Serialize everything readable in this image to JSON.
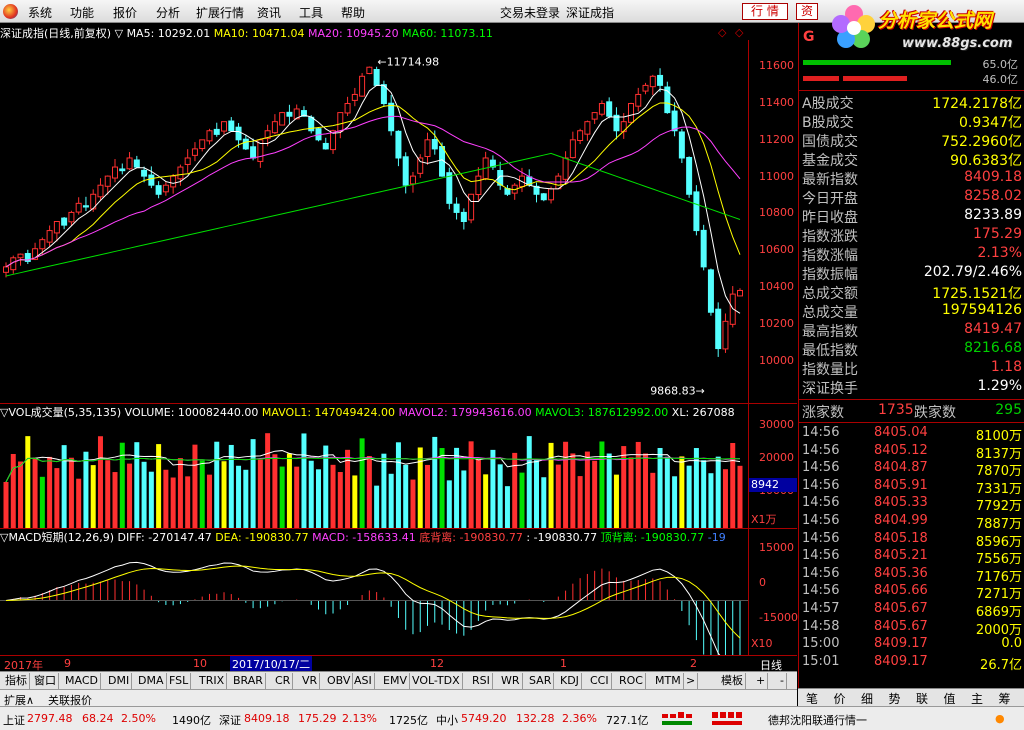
{
  "menu": {
    "items": [
      "系统",
      "功能",
      "报价",
      "分析",
      "扩展行情",
      "资讯",
      "工具",
      "帮助"
    ],
    "login_status": "交易未登录",
    "current_index": "深证成指",
    "btn_quotes": "行 情",
    "btn_info": "资"
  },
  "brand": {
    "title": "分析家公式网",
    "url": "www.88gs.com"
  },
  "main_info": {
    "name": "深证成指(日线,前复权)",
    "ma5": "MA5: 10292.01",
    "ma10": "MA10: 10471.04",
    "ma20": "MA20: 10945.20",
    "ma60": "MA60: 11073.11",
    "high_mark": "11714.98",
    "low_mark": "9868.83"
  },
  "price_axis": [
    "11600",
    "11400",
    "11200",
    "11000",
    "10800",
    "10600",
    "10400",
    "10200",
    "10000"
  ],
  "vol_info": {
    "name": "VOL成交量(5,35,135)",
    "volume": "VOLUME: 100082440.00",
    "mavol1": "MAVOL1: 147049424.00",
    "mavol2": "MAVOL2: 179943616.00",
    "mavol3": "MAVOL3: 187612992.00",
    "xl": "XL: 267088"
  },
  "vol_axis": [
    "30000",
    "20000",
    "10000"
  ],
  "vol_box": "8942",
  "vol_unit": "X1万",
  "macd_info": {
    "name": "MACD短期(12,26,9)",
    "diff": "DIFF: -270147.47",
    "dea": "DEA: -190830.77",
    "macd": "MACD: -158633.41",
    "bottom_div": "底背离: -190830.77",
    "colon": ": -190830.77",
    "top_div": "顶背离: -190830.77",
    "last": "-19"
  },
  "macd_axis": [
    "15000",
    "0",
    "-15000"
  ],
  "macd_unit": "X10",
  "time_axis": {
    "year": "2017年",
    "m9": "9",
    "m10": "10",
    "date": "2017/10/17/二",
    "m12": "12",
    "m1": "1",
    "m2": "2",
    "period": "日线"
  },
  "tabs": [
    "指标",
    "窗口",
    "MACD",
    "DMI",
    "DMA",
    "FSL",
    "TRIX",
    "BRAR",
    "CR",
    "VR",
    "OBV",
    "ASI",
    "EMV",
    "VOL-TDX",
    "RSI",
    "WR",
    "SAR",
    "KDJ",
    "CCI",
    "ROC",
    "MTM",
    ">",
    "模板",
    "+",
    "-"
  ],
  "expand": {
    "expand": "扩展∧",
    "related": "关联报价"
  },
  "status": {
    "sh_label": "上证",
    "sh_price": "2797.48",
    "sh_chg": "68.24",
    "sh_pct": "2.50%",
    "sh_amt": "1490亿",
    "sz_label": "深证",
    "sz_price": "8409.18",
    "sz_chg": "175.29",
    "sz_pct": "2.13%",
    "sz_amt": "1725亿",
    "zx_label": "中小",
    "zx_price": "5749.20",
    "zx_chg": "132.28",
    "zx_pct": "2.36%",
    "zx_amt": "727.1亿",
    "broker": "德邦沈阳联通行情一"
  },
  "rpanel": {
    "code": "G",
    "vol_a": "65.0亿",
    "vol_b": "46.0亿",
    "stats": [
      {
        "label": "A股成交",
        "value": "1724.2178亿",
        "color": "#ffff00"
      },
      {
        "label": "B股成交",
        "value": "0.9347亿",
        "color": "#ffff00"
      },
      {
        "label": "国债成交",
        "value": "752.2960亿",
        "color": "#ffff00"
      },
      {
        "label": "基金成交",
        "value": "90.6383亿",
        "color": "#ffff00"
      },
      {
        "label": "最新指数",
        "value": "8409.18",
        "color": "#ff4040"
      },
      {
        "label": "今日开盘",
        "value": "8258.02",
        "color": "#ff4040"
      },
      {
        "label": "昨日收盘",
        "value": "8233.89",
        "color": "#ffffff"
      },
      {
        "label": "指数涨跌",
        "value": "175.29",
        "color": "#ff4040"
      },
      {
        "label": "指数涨幅",
        "value": "2.13%",
        "color": "#ff4040"
      },
      {
        "label": "指数振幅",
        "value": "202.79/2.46%",
        "color": "#ffffff"
      },
      {
        "label": "总成交额",
        "value": "1725.1521亿",
        "color": "#ffff00"
      },
      {
        "label": "总成交量",
        "value": "197594126",
        "color": "#ffff00"
      },
      {
        "label": "最高指数",
        "value": "8419.47",
        "color": "#ff4040"
      },
      {
        "label": "最低指数",
        "value": "8216.68",
        "color": "#00d000"
      },
      {
        "label": "指数量比",
        "value": "1.18",
        "color": "#ff4040"
      },
      {
        "label": "深证换手",
        "value": "1.29%",
        "color": "#ffffff"
      }
    ],
    "up_label": "涨家数",
    "up_count": "1735",
    "down_label": "跌家数",
    "down_count": "295",
    "ticks": [
      {
        "t": "14:56",
        "p": "8405.04",
        "q": "8100万"
      },
      {
        "t": "14:56",
        "p": "8405.12",
        "q": "8137万"
      },
      {
        "t": "14:56",
        "p": "8404.87",
        "q": "7870万"
      },
      {
        "t": "14:56",
        "p": "8405.91",
        "q": "7331万"
      },
      {
        "t": "14:56",
        "p": "8405.33",
        "q": "7792万"
      },
      {
        "t": "14:56",
        "p": "8404.99",
        "q": "7887万"
      },
      {
        "t": "14:56",
        "p": "8405.18",
        "q": "8596万"
      },
      {
        "t": "14:56",
        "p": "8405.21",
        "q": "7556万"
      },
      {
        "t": "14:56",
        "p": "8405.36",
        "q": "7176万"
      },
      {
        "t": "14:56",
        "p": "8405.66",
        "q": "7271万"
      },
      {
        "t": "14:57",
        "p": "8405.67",
        "q": "6869万"
      },
      {
        "t": "14:58",
        "p": "8405.67",
        "q": "2000万"
      },
      {
        "t": "15:00",
        "p": "8409.17",
        "q": "0.0"
      },
      {
        "t": "15:01",
        "p": "8409.17",
        "q": "26.7亿"
      }
    ],
    "tabs": [
      "笔",
      "价",
      "细",
      "势",
      "联",
      "值",
      "主",
      "筹"
    ]
  },
  "chart_data": {
    "type": "candlestick",
    "title": "深证成指(日线,前复权)",
    "ylim": [
      9800,
      11800
    ],
    "high": 11714.98,
    "low": 9868.83,
    "closes": [
      10550,
      10600,
      10620,
      10580,
      10650,
      10700,
      10750,
      10800,
      10780,
      10850,
      10900,
      10880,
      10950,
      11000,
      11050,
      11100,
      11080,
      11150,
      11100,
      11050,
      11000,
      10950,
      11000,
      11050,
      11100,
      11150,
      11200,
      11250,
      11300,
      11280,
      11350,
      11300,
      11250,
      11200,
      11150,
      11250,
      11300,
      11350,
      11400,
      11380,
      11420,
      11380,
      11300,
      11250,
      11200,
      11300,
      11400,
      11450,
      11500,
      11600,
      11650,
      11550,
      11450,
      11300,
      11150,
      11000,
      11050,
      11150,
      11250,
      11200,
      11050,
      10900,
      10850,
      10800,
      10950,
      11050,
      11150,
      11100,
      11000,
      10950,
      11000,
      11050,
      11000,
      10950,
      10920,
      10980,
      11050,
      11150,
      11250,
      11300,
      11350,
      11400,
      11450,
      11380,
      11300,
      11350,
      11450,
      11500,
      11550,
      11600,
      11550,
      11400,
      11300,
      11150,
      10950,
      10750,
      10550,
      10300,
      10100,
      10250,
      10400,
      10420
    ]
  }
}
